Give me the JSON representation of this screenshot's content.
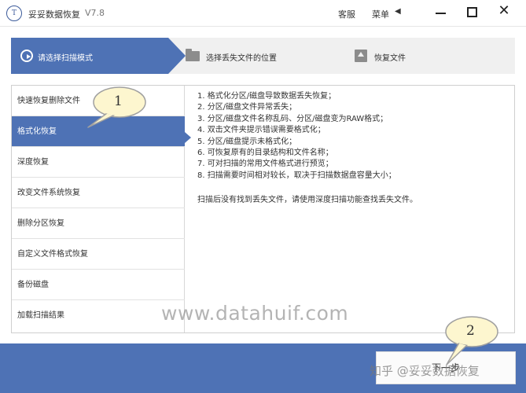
{
  "titlebar": {
    "logo_text": "T",
    "app_title": "妥妥数据恢复",
    "version": "V7.8",
    "service_label": "客服",
    "menu_label": "菜单",
    "menu_arrow": "◀",
    "close_symbol": "✕"
  },
  "steps": [
    {
      "label": "请选择扫描模式",
      "icon": "play-circle-icon",
      "active": true
    },
    {
      "label": "选择丢失文件的位置",
      "icon": "folder-icon",
      "active": false
    },
    {
      "label": "恢复文件",
      "icon": "upload-icon",
      "active": false
    }
  ],
  "modes": [
    {
      "label": "快速恢复删除文件"
    },
    {
      "label": "格式化恢复"
    },
    {
      "label": "深度恢复"
    },
    {
      "label": "改变文件系统恢复"
    },
    {
      "label": "删除分区恢复"
    },
    {
      "label": "自定义文件格式恢复"
    },
    {
      "label": "备份磁盘"
    },
    {
      "label": "加载扫描结果"
    }
  ],
  "selected_mode": "格式化恢复",
  "description": {
    "lines": [
      "1. 格式化分区/磁盘导致数据丢失恢复；",
      "2. 分区/磁盘文件异常丢失；",
      "3. 分区/磁盘文件名称乱码、分区/磁盘变为RAW格式；",
      "4. 双击文件夹提示错误需要格式化；",
      "5. 分区/磁盘提示未格式化；",
      "6. 可恢复原有的目录结构和文件名称；",
      "7. 可对扫描的常用文件格式进行预览；",
      "8. 扫描需要时间相对较长，取决于扫描数据盘容量大小；"
    ],
    "note": "扫描后没有找到丢失文件，请使用深度扫描功能查找丢失文件。"
  },
  "watermark": "www.datahuif.com",
  "next_button_label": "下一步",
  "zhihu_watermark": "知乎 @妥妥数据恢复",
  "annotations": {
    "first": "1",
    "second": "2"
  },
  "colors": {
    "accent": "#4e72b5",
    "callout_fill": "#fdf6cf"
  }
}
